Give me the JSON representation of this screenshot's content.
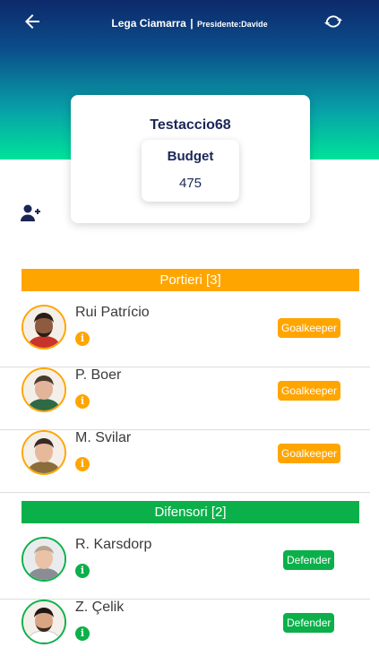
{
  "header": {
    "league": "Lega Ciamarra",
    "separator": "|",
    "president": "Presidente:Davide"
  },
  "icons": {
    "back": "arrow-left-icon",
    "refresh": "refresh-icon",
    "add_user": "add-user-icon",
    "info": "info-icon"
  },
  "team": {
    "name": "Testaccio68",
    "budget_label": "Budget",
    "budget_value": "475"
  },
  "colors": {
    "goalkeeper": "#ffa500",
    "defender": "#0cb04a",
    "title": "#1a2657"
  },
  "sections": {
    "goalkeepers": {
      "title": "Portieri [3]",
      "players": [
        {
          "name": "Rui Patrício",
          "role": "Goalkeeper"
        },
        {
          "name": "P. Boer",
          "role": "Goalkeeper"
        },
        {
          "name": "M. Svilar",
          "role": "Goalkeeper"
        }
      ]
    },
    "defenders": {
      "title": "Difensori [2]",
      "players": [
        {
          "name": "R. Karsdorp",
          "role": "Defender"
        },
        {
          "name": "Z. Çelik",
          "role": "Defender"
        }
      ]
    }
  }
}
